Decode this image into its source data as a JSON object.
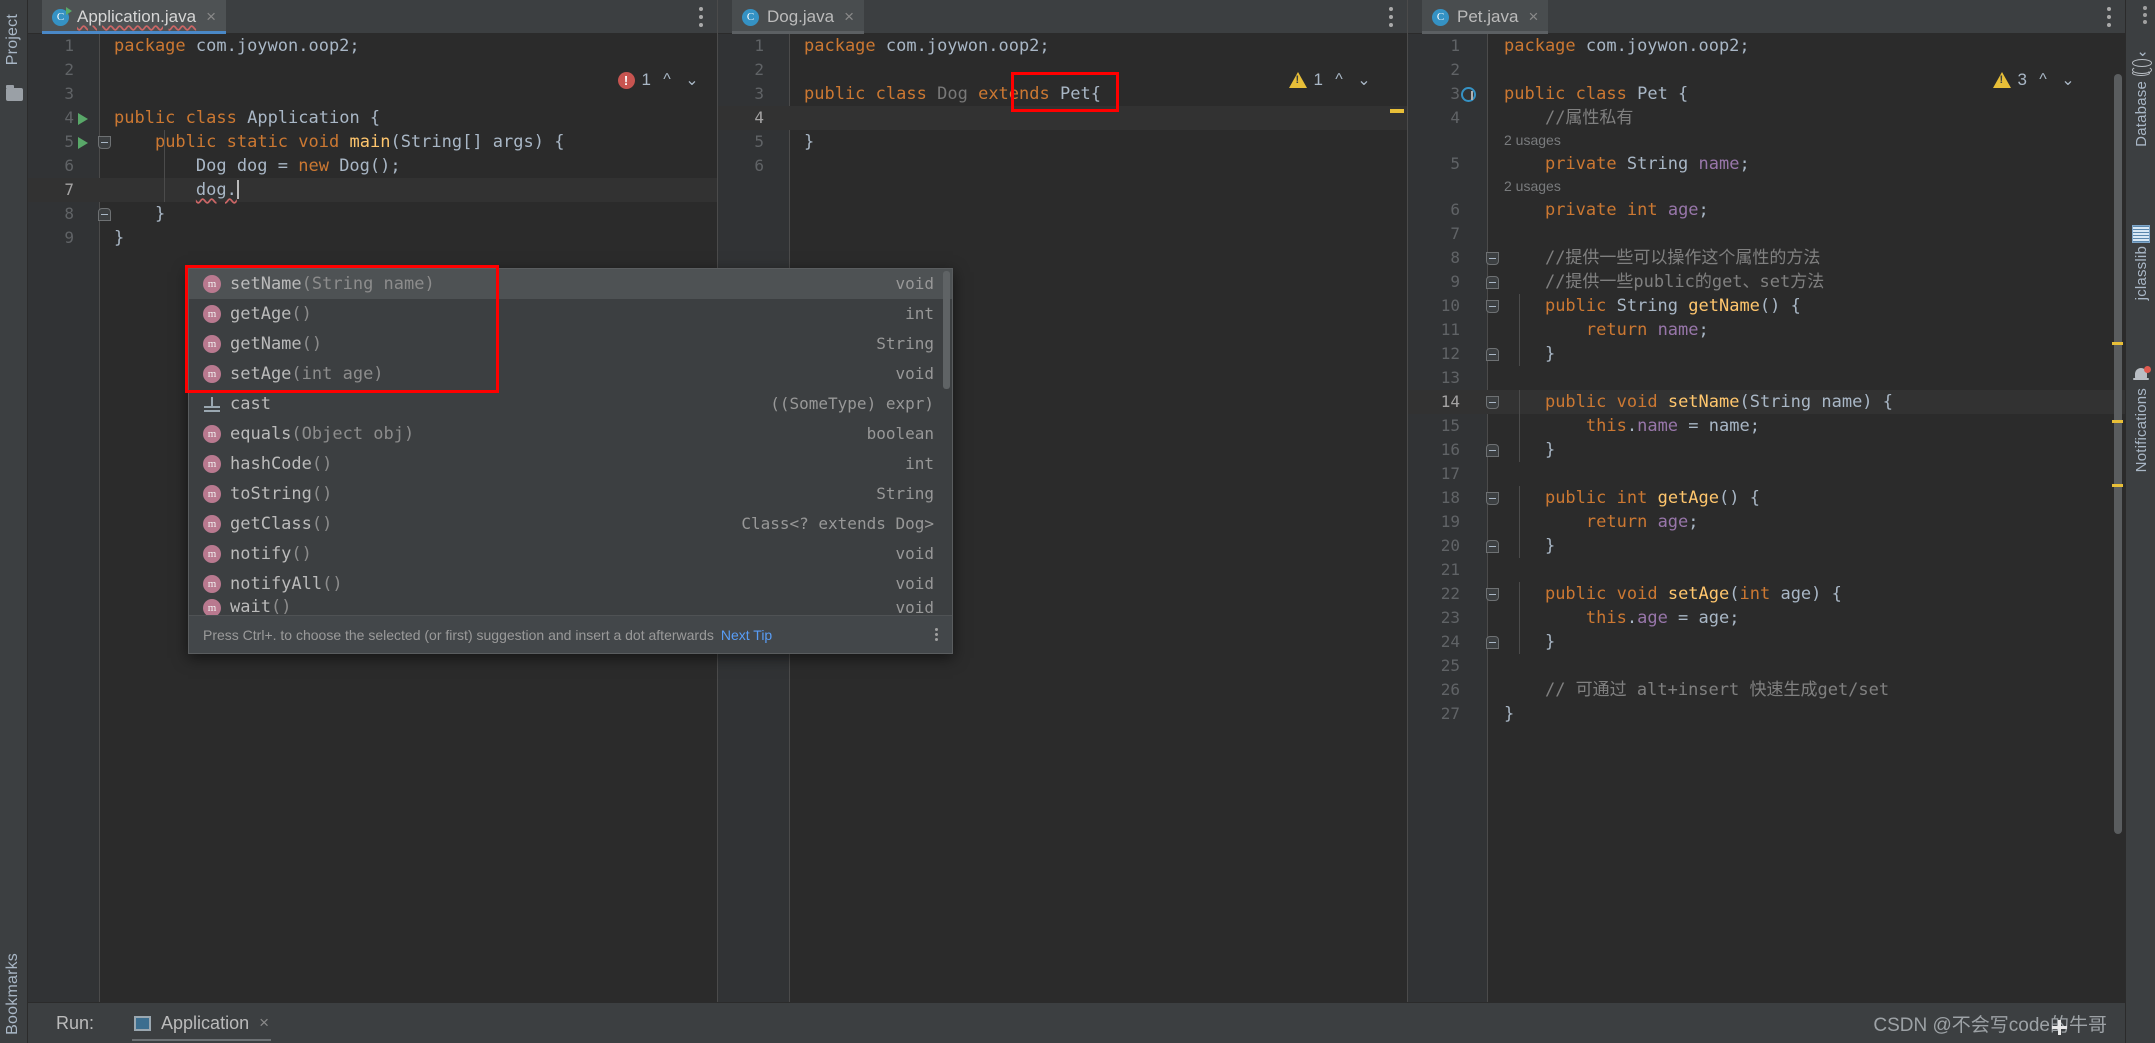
{
  "left_strip": {
    "project_label": "Project",
    "bookmarks_label": "Bookmarks",
    "folder_icon": "folder-icon"
  },
  "right_strip": {
    "items": [
      {
        "label": "Database",
        "icon": "database-icon"
      },
      {
        "label": "jclasslib",
        "icon": "jclasslib-icon"
      },
      {
        "label": "Notifications",
        "icon": "bell-icon"
      }
    ]
  },
  "editors": [
    {
      "tab": {
        "title": "Application.java",
        "icon": "java-class-runnable-icon",
        "close": "×",
        "active": true
      },
      "inspection": {
        "type": "error",
        "count": "1",
        "up": "⌃",
        "down": "⌄"
      },
      "lines": [
        {
          "n": "1",
          "html": "<span class=\"kw\">package</span> com.joywon.oop2;"
        },
        {
          "n": "2",
          "html": ""
        },
        {
          "n": "3",
          "html": ""
        },
        {
          "n": "4",
          "html": "<span class=\"kw\">public</span> <span class=\"kw\">class</span> Application {",
          "run": true
        },
        {
          "n": "5",
          "html": "    <span class=\"kw\">public</span> <span class=\"kw\">static</span> <span class=\"kw\">void</span> <span class=\"fn\">main</span>(String[] args) {",
          "run": true,
          "fold": "open"
        },
        {
          "n": "6",
          "html": "        Dog dog = <span class=\"kw\">new</span> <span class=\"typ\">Dog</span>();"
        },
        {
          "n": "7",
          "html": "        dog."
        },
        {
          "n": "8",
          "html": "    }",
          "fold": "close"
        },
        {
          "n": "9",
          "html": "}"
        }
      ]
    },
    {
      "tab": {
        "title": "Dog.java",
        "icon": "java-class-icon",
        "close": "×",
        "active": false
      },
      "inspection": {
        "type": "warning",
        "count": "1",
        "up": "⌃",
        "down": "⌄"
      },
      "lines": [
        {
          "n": "1",
          "html": "<span class=\"kw\">package</span> com.joywon.oop2;"
        },
        {
          "n": "2",
          "html": ""
        },
        {
          "n": "3",
          "html": "<span class=\"kw\">public</span> <span class=\"kw\">class</span> <span class=\"grey\">Dog</span> <span class=\"kw\">extends</span> <span class=\"typ\">Pet</span>{"
        },
        {
          "n": "4",
          "html": ""
        },
        {
          "n": "5",
          "html": "}"
        },
        {
          "n": "6",
          "html": ""
        }
      ]
    },
    {
      "tab": {
        "title": "Pet.java",
        "icon": "java-class-icon",
        "close": "×",
        "active": false
      },
      "inspection": {
        "type": "warning",
        "count": "3",
        "up": "⌃",
        "down": "⌄"
      },
      "lines": [
        {
          "n": "1",
          "html": "<span class=\"kw\">package</span> com.joywon.oop2;"
        },
        {
          "n": "2",
          "html": ""
        },
        {
          "n": "3",
          "html": "<span class=\"kw\">public</span> <span class=\"kw\">class</span> <span class=\"typ\">Pet</span> {",
          "bookmark": true
        },
        {
          "n": "4",
          "html": "    <span class=\"cmt\">//属性私有</span>"
        },
        {
          "n": "",
          "usages": "2 usages"
        },
        {
          "n": "5",
          "html": "    <span class=\"kw\">private</span> String <span class=\"fld\">name</span>;"
        },
        {
          "n": "",
          "usages": "2 usages"
        },
        {
          "n": "6",
          "html": "    <span class=\"kw\">private</span> <span class=\"kw\">int</span> <span class=\"fld\">age</span>;"
        },
        {
          "n": "7",
          "html": ""
        },
        {
          "n": "8",
          "html": "    <span class=\"cmt\">//提供一些可以操作这个属性的方法</span>",
          "fold": "open"
        },
        {
          "n": "9",
          "html": "    <span class=\"cmt\">//提供一些public的get、set方法</span>",
          "fold": "close"
        },
        {
          "n": "10",
          "html": "    <span class=\"kw\">public</span> String <span class=\"fn\">getName</span>() {",
          "fold": "open"
        },
        {
          "n": "11",
          "html": "        <span class=\"kw\">return</span> <span class=\"fld\">name</span>;"
        },
        {
          "n": "12",
          "html": "    }",
          "fold": "close"
        },
        {
          "n": "13",
          "html": ""
        },
        {
          "n": "14",
          "html": "    <span class=\"kw\">public</span> <span class=\"kw\">void</span> <span class=\"fn\">setName</span>(String name) {",
          "fold": "open",
          "hl": true
        },
        {
          "n": "15",
          "html": "        <span class=\"kw\">this</span>.<span class=\"fld\">name</span> = name;"
        },
        {
          "n": "16",
          "html": "    }",
          "fold": "close"
        },
        {
          "n": "17",
          "html": ""
        },
        {
          "n": "18",
          "html": "    <span class=\"kw\">public</span> <span class=\"kw\">int</span> <span class=\"fn\">getAge</span>() {",
          "fold": "open"
        },
        {
          "n": "19",
          "html": "        <span class=\"kw\">return</span> <span class=\"fld\">age</span>;"
        },
        {
          "n": "20",
          "html": "    }",
          "fold": "close"
        },
        {
          "n": "21",
          "html": ""
        },
        {
          "n": "22",
          "html": "    <span class=\"kw\">public</span> <span class=\"kw\">void</span> <span class=\"fn\">setAge</span>(<span class=\"kw\">int</span> age) {",
          "fold": "open"
        },
        {
          "n": "23",
          "html": "        <span class=\"kw\">this</span>.<span class=\"fld\">age</span> = age;"
        },
        {
          "n": "24",
          "html": "    }",
          "fold": "close"
        },
        {
          "n": "25",
          "html": ""
        },
        {
          "n": "26",
          "html": "    <span class=\"cmt\">// 可通过 alt+insert 快速生成get/set</span>"
        },
        {
          "n": "27",
          "html": "}"
        }
      ]
    }
  ],
  "completion_popup": {
    "items": [
      {
        "icon": "method-icon",
        "name": "setName",
        "sig": "(String name)",
        "type": "void",
        "selected": true,
        "highlighted": true
      },
      {
        "icon": "method-icon",
        "name": "getAge",
        "sig": "()",
        "type": "int",
        "selected": false,
        "highlighted": true
      },
      {
        "icon": "method-icon",
        "name": "getName",
        "sig": "()",
        "type": "String",
        "selected": false,
        "highlighted": true
      },
      {
        "icon": "method-icon",
        "name": "setAge",
        "sig": "(int age)",
        "type": "void",
        "selected": false,
        "highlighted": true
      },
      {
        "icon": "cast-icon",
        "name": "cast",
        "sig": "",
        "type": "((SomeType) expr)",
        "selected": false,
        "highlighted": false
      },
      {
        "icon": "method-icon",
        "name": "equals",
        "sig": "(Object obj)",
        "type": "boolean",
        "selected": false,
        "highlighted": false
      },
      {
        "icon": "method-icon",
        "name": "hashCode",
        "sig": "()",
        "type": "int",
        "selected": false,
        "highlighted": false
      },
      {
        "icon": "method-icon",
        "name": "toString",
        "sig": "()",
        "type": "String",
        "selected": false,
        "highlighted": false
      },
      {
        "icon": "method-icon",
        "name": "getClass",
        "sig": "()",
        "type": "Class<? extends Dog>",
        "selected": false,
        "highlighted": false
      },
      {
        "icon": "method-icon",
        "name": "notify",
        "sig": "()",
        "type": "void",
        "selected": false,
        "highlighted": false
      },
      {
        "icon": "method-icon",
        "name": "notifyAll",
        "sig": "()",
        "type": "void",
        "selected": false,
        "highlighted": false
      },
      {
        "icon": "method-icon",
        "name": "wait",
        "sig": "()",
        "type": "void",
        "selected": false,
        "highlighted": false
      }
    ],
    "hint_text": "Press Ctrl+. to choose the selected (or first) suggestion and insert a dot afterwards",
    "hint_link": "Next Tip"
  },
  "bottom_bar": {
    "run_label": "Run:",
    "run_tab": {
      "title": "Application",
      "icon": "run-config-icon",
      "close": "×"
    },
    "watermark": "CSDN @不会写code的牛哥"
  },
  "accent_colors": {
    "editor_bg": "#2b2b2b",
    "chrome_bg": "#3c3f41",
    "keyword": "#cc7832",
    "method": "#ffc66d",
    "field": "#9876aa",
    "comment": "#808080",
    "error": "#c75450",
    "warning": "#e8bf38",
    "tab_underline": "#4a88c7",
    "highlight_box": "#ff0000"
  }
}
